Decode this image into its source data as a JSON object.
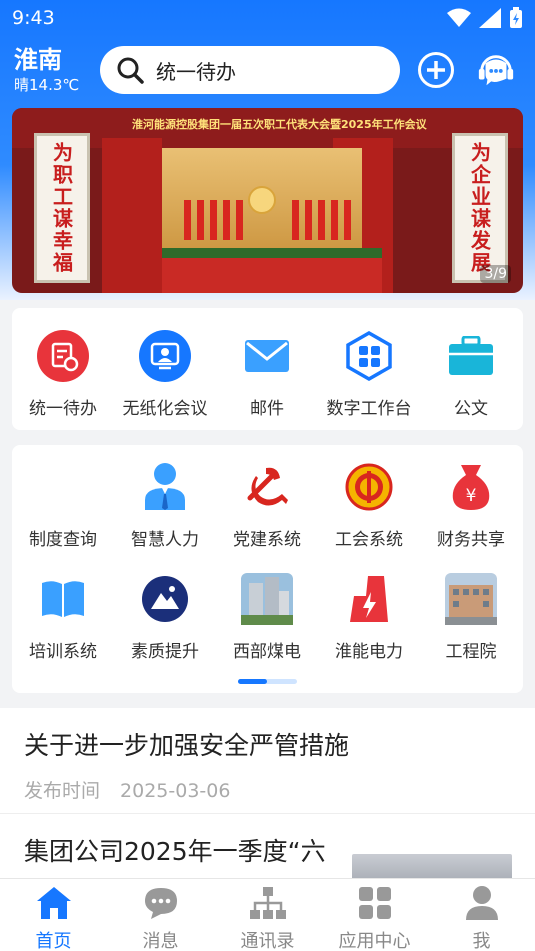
{
  "status_bar": {
    "time": "9:43"
  },
  "header": {
    "city": "淮南",
    "weather": "晴14.3℃",
    "search_text": "统一待办"
  },
  "banner": {
    "title": "淮河能源控股集团一届五次职工代表大会暨2025年工作会议",
    "left_banner": "为职工谋幸福",
    "right_banner": "为企业谋发展",
    "counter": "3/9"
  },
  "quick_apps": [
    {
      "label": "统一待办",
      "icon": "todo-icon"
    },
    {
      "label": "无纸化会议",
      "icon": "meeting-icon"
    },
    {
      "label": "邮件",
      "icon": "mail-icon"
    },
    {
      "label": "数字工作台",
      "icon": "workbench-icon"
    },
    {
      "label": "公文",
      "icon": "briefcase-icon"
    }
  ],
  "apps": [
    {
      "label": "制度查询",
      "icon": "none"
    },
    {
      "label": "智慧人力",
      "icon": "person-icon"
    },
    {
      "label": "党建系统",
      "icon": "party-icon"
    },
    {
      "label": "工会系统",
      "icon": "union-icon"
    },
    {
      "label": "财务共享",
      "icon": "money-bag-icon"
    },
    {
      "label": "培训系统",
      "icon": "book-icon"
    },
    {
      "label": "素质提升",
      "icon": "mountain-icon"
    },
    {
      "label": "西部煤电",
      "icon": "building-photo-icon"
    },
    {
      "label": "淮能电力",
      "icon": "power-icon"
    },
    {
      "label": "工程院",
      "icon": "building-photo-icon"
    }
  ],
  "news": [
    {
      "title": "关于进一步加强安全严管措施",
      "meta_label": "发布时间",
      "date": "2025-03-06"
    },
    {
      "title": "集团公司2025年一季度“六"
    }
  ],
  "tabs": [
    {
      "label": "首页",
      "icon": "home-icon"
    },
    {
      "label": "消息",
      "icon": "message-icon"
    },
    {
      "label": "通讯录",
      "icon": "org-chart-icon"
    },
    {
      "label": "应用中心",
      "icon": "apps-icon"
    },
    {
      "label": "我",
      "icon": "user-icon"
    }
  ],
  "colors": {
    "primary": "#1677ff",
    "red": "#e8343b"
  }
}
